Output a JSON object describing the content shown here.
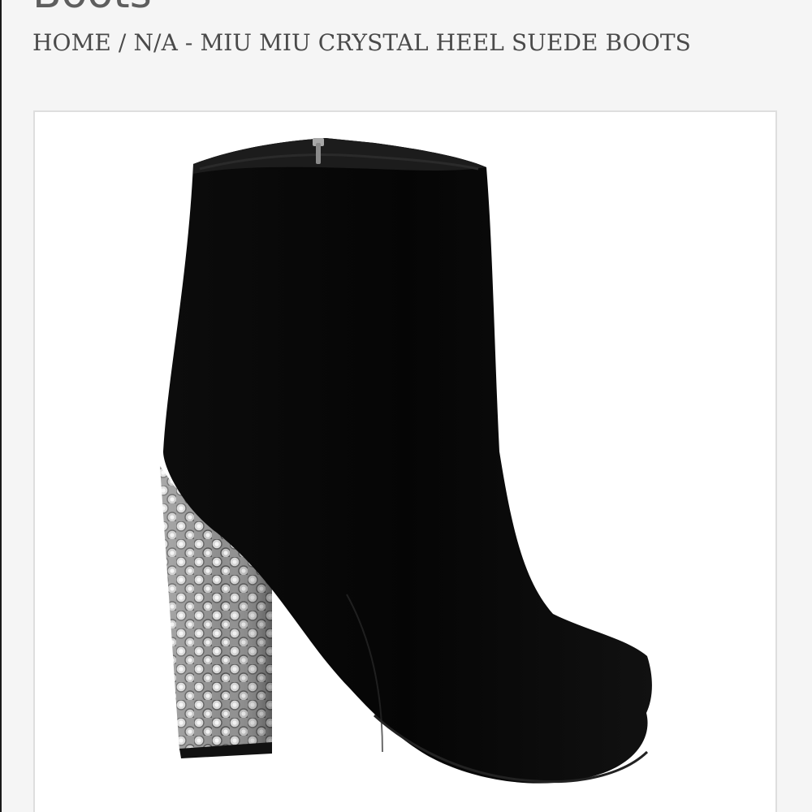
{
  "page": {
    "title": "Boots",
    "background": "#f5f5f5"
  },
  "breadcrumb": {
    "home_label": "HOME",
    "separator": " / ",
    "current": "N/A - MIU MIU CRYSTAL HEEL SUEDE BOOTS"
  },
  "product": {
    "image_icon": "suede-ankle-boot-crystal-heel",
    "colors": {
      "suede": "#080808",
      "crystal": "#c9c9c9",
      "card": "#ffffff"
    }
  }
}
